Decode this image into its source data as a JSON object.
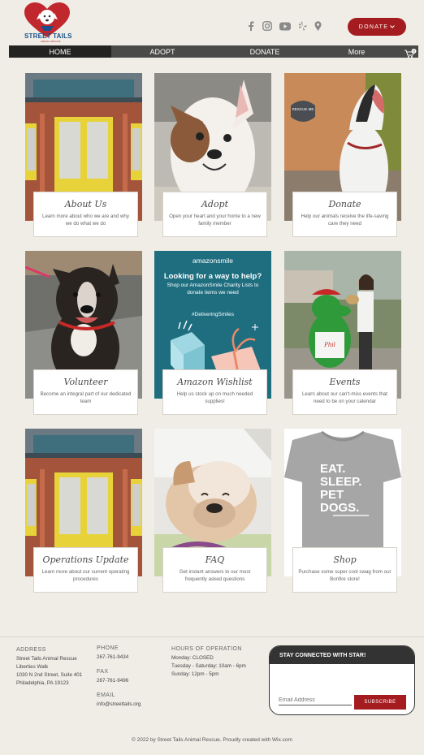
{
  "brand": {
    "name": "STREET TAILS",
    "tagline": "ANIMAL RESCUE",
    "colors": {
      "accent": "#a51c20",
      "navy": "#1a4f8c",
      "nav_bg": "#4a4a48",
      "nav_active": "#232322",
      "page_bg": "#efede6"
    }
  },
  "header": {
    "social_icons": [
      "facebook-icon",
      "instagram-icon",
      "youtube-icon",
      "yelp-icon",
      "map-pin-icon"
    ],
    "donate_label": "DONATE",
    "cart_count": "0"
  },
  "nav": {
    "items": [
      {
        "label": "HOME"
      },
      {
        "label": "ADOPT"
      },
      {
        "label": "DONATE"
      },
      {
        "label": "More"
      }
    ]
  },
  "cards": [
    {
      "title": "About Us",
      "desc": "Learn more about who we are and why we do what we do"
    },
    {
      "title": "Adopt",
      "desc": "Open your heart and your home to a new family member"
    },
    {
      "title": "Donate",
      "desc": "Help our animals receive the life-saving care they need"
    },
    {
      "title": "Volunteer",
      "desc": "Become an integral part of our dedicated team"
    },
    {
      "title": "Amazon Wishlist",
      "desc": "Help us stock up on much needed supplies!"
    },
    {
      "title": "Events",
      "desc": "Learn about our can't-miss events that need to be on your calendar"
    },
    {
      "title": "Operations Update",
      "desc": "Learn more about our current operating procedures"
    },
    {
      "title": "FAQ",
      "desc": "Get instant answers to our most frequently asked questions"
    },
    {
      "title": "Shop",
      "desc": "Purchase some super cool swag from our Bonfire store!"
    }
  ],
  "images": {
    "rescue_sign": "RESCUE ME",
    "amazon": {
      "brand": "amazonsmile",
      "headline": "Looking for a way to help?",
      "body": "Shop our AmazonSmile Charity Lists to donate items we need",
      "hashtag": "#DeliveringSmiles"
    },
    "shirt": {
      "line1": "EAT.",
      "line2": "SLEEP.",
      "line3": "PET",
      "line4": "DOGS."
    }
  },
  "footer": {
    "address": {
      "heading": "ADDRESS",
      "lines": [
        "Street Tails Animal Rescue",
        "Liberties Walk",
        "1030 N 2nd Street, Suite 401",
        "Philadelphia, PA 19123"
      ]
    },
    "phone": {
      "heading": "PHONE",
      "value": "267-761-9434"
    },
    "fax": {
      "heading": "FAX",
      "value": "267-761-9496"
    },
    "email": {
      "heading": "EMAIL",
      "value": "info@streettails.org"
    },
    "hours": {
      "heading": "HOURS OF OPERATION",
      "lines": [
        "Monday: CLOSED",
        "Tuesday - Saturday: 10am - 6pm",
        "Sunday: 12pm - 5pm"
      ]
    },
    "signup": {
      "heading": "STAY CONNECTED WITH STAR!",
      "placeholder": "Email Address",
      "button": "SUBSCRIBE"
    },
    "copyright": "© 2022 by Street Tails Animal Rescue. Proudly created with Wix.com"
  }
}
